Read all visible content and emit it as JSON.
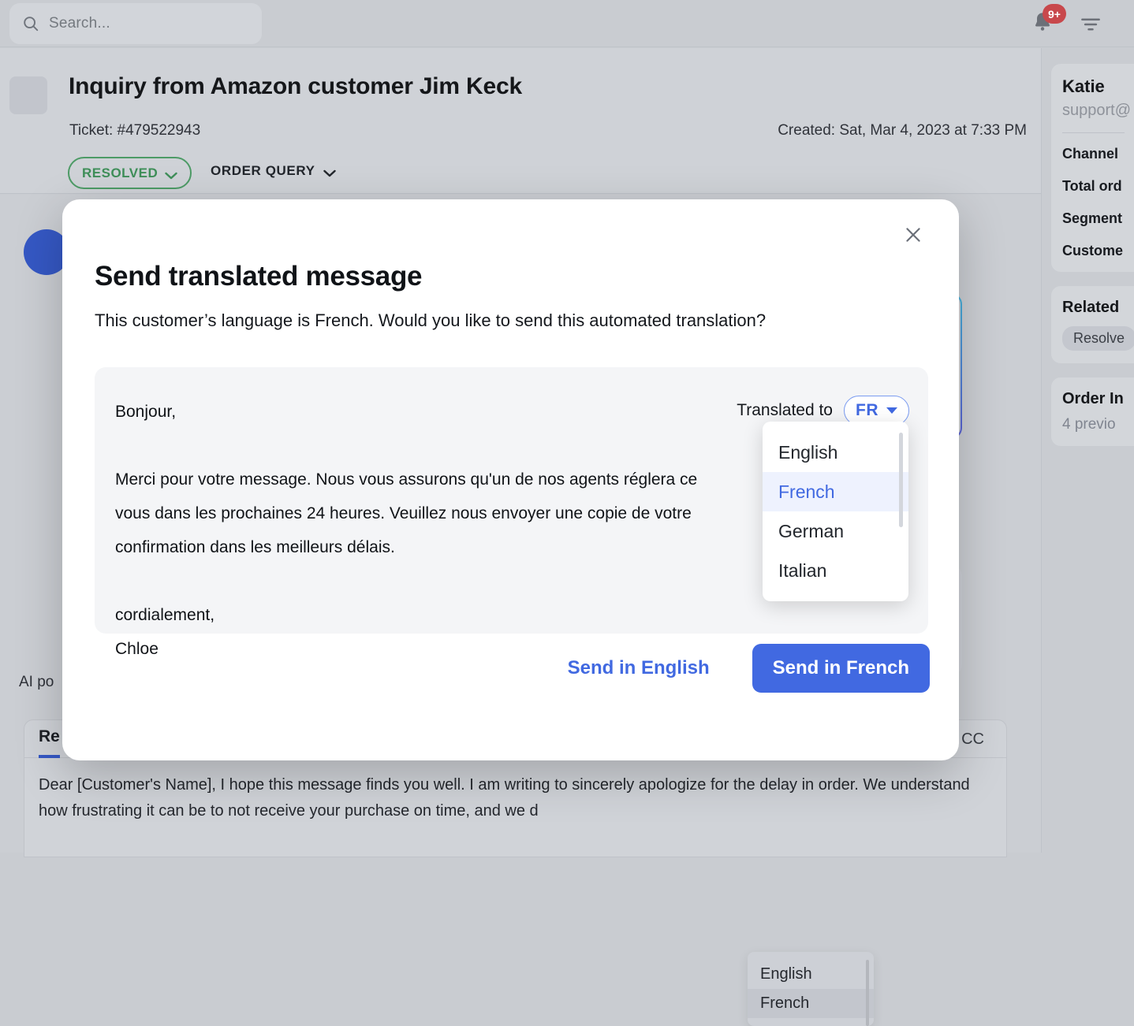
{
  "topbar": {
    "search_placeholder": "Search...",
    "notification_count": "9+"
  },
  "ticket": {
    "title": "Inquiry from Amazon customer Jim Keck",
    "ticket_label": "Ticket: #479522943",
    "created_label": "Created: Sat, Mar 4, 2023 at 7:33 PM",
    "status": "RESOLVED",
    "category": "ORDER QUERY"
  },
  "conversation": {
    "ai_powered_label": "AI po"
  },
  "reply_editor": {
    "tab_reply": "Re",
    "tab_cc": "CC",
    "body": "Dear [Customer's Name],\nI hope this message finds you well. I am writing to sincerely apologize for the delay in                                       order. We\nunderstand how frustrating it can be to not receive your purchase on time, and we d"
  },
  "background_language_dropdown": {
    "options": [
      "English",
      "French"
    ],
    "selected": "French"
  },
  "sidebar": {
    "customer_name": "Katie",
    "customer_email": "support@",
    "fields": [
      "Channel",
      "Total ord",
      "Segment",
      "Custome"
    ],
    "related_title": "Related",
    "related_tag": "Resolve",
    "order_title": "Order In",
    "order_sub": "4 previo"
  },
  "modal": {
    "title": "Send translated message",
    "subtitle": "This customer’s language is French. Would you like to send this automated translation?",
    "message": "Bonjour,\n\nMerci pour votre message. Nous vous assurons qu'un de nos agents réglera ce\nvous dans les prochaines 24 heures. Veuillez nous envoyer une copie de votre\nconfirmation dans les meilleurs délais.\n\ncordialement,\nChloe",
    "translated_to_label": "Translated to",
    "language_code": "FR",
    "language_options": [
      "English",
      "French",
      "German",
      "Italian"
    ],
    "selected_language": "French",
    "secondary_action": "Send in English",
    "primary_action": "Send in French"
  },
  "colors": {
    "accent": "#4169e1",
    "status_green": "#3f8f59",
    "badge_red": "#c8484c"
  }
}
